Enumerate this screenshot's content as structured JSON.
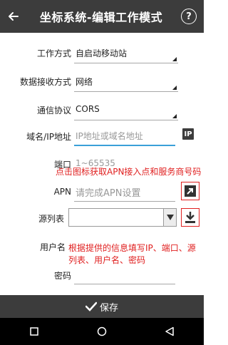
{
  "header": {
    "title": "坐标系统-编辑工作模式",
    "help": "?"
  },
  "form": {
    "work_mode": {
      "label": "工作方式",
      "value": "自启动移动站"
    },
    "data_mode": {
      "label": "数据接收方式",
      "value": "网络"
    },
    "protocol": {
      "label": "通信协议",
      "value": "CORS"
    },
    "domain": {
      "label": "域名/IP地址",
      "placeholder": "IP地址或域名地址",
      "button": "IP"
    },
    "port": {
      "label": "端口",
      "placeholder": "1~65535"
    },
    "apn": {
      "label": "APN",
      "placeholder": "请完成APN设置"
    },
    "source_table": {
      "label": "源列表",
      "value": ""
    },
    "username": {
      "label": "用户名"
    },
    "password": {
      "label": "密码"
    }
  },
  "notes": {
    "apn_hint": "点击图标获取APN接入点和服务商号码",
    "fill_hint": "根据提供的信息填写IP、端口、源列表、用户名、密码"
  },
  "footer": {
    "save_label": "保存"
  },
  "colors": {
    "header_bg": "#3c3c3c",
    "accent": "#3aa0d8",
    "annotation": "#e02020"
  }
}
